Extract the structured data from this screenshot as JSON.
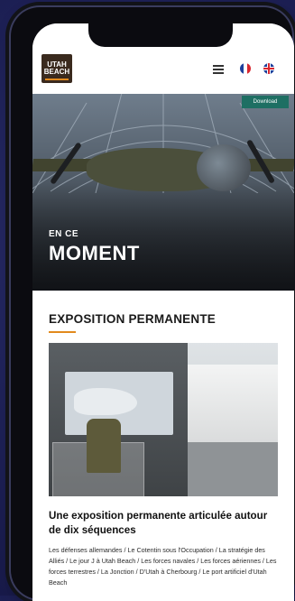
{
  "header": {
    "logo_line1": "UTAH",
    "logo_line2": "BEACH",
    "language_options": [
      "fr",
      "en"
    ]
  },
  "hero": {
    "download_label": "Download",
    "small_title": "EN CE",
    "big_title": "MOMENT"
  },
  "section": {
    "title": "EXPOSITION PERMANENTE"
  },
  "card": {
    "title": "Une exposition permanente articulée autour de dix séquences",
    "text": "Les défenses allemandes / Le Cotentin sous l'Occupation / La stratégie des Alliés / Le jour J à Utah Beach / Les forces navales / Les forces aériennes / Les forces terrestres / La Jonction / D'Utah à Cherbourg / Le port artificiel d'Utah Beach"
  },
  "colors": {
    "accent": "#e28a1d",
    "page_background": "#1e2157",
    "download_button": "#1e6f63"
  },
  "icons": {
    "menu": "hamburger-icon",
    "flag_fr": "flag-fr-icon",
    "flag_uk": "flag-uk-icon"
  }
}
